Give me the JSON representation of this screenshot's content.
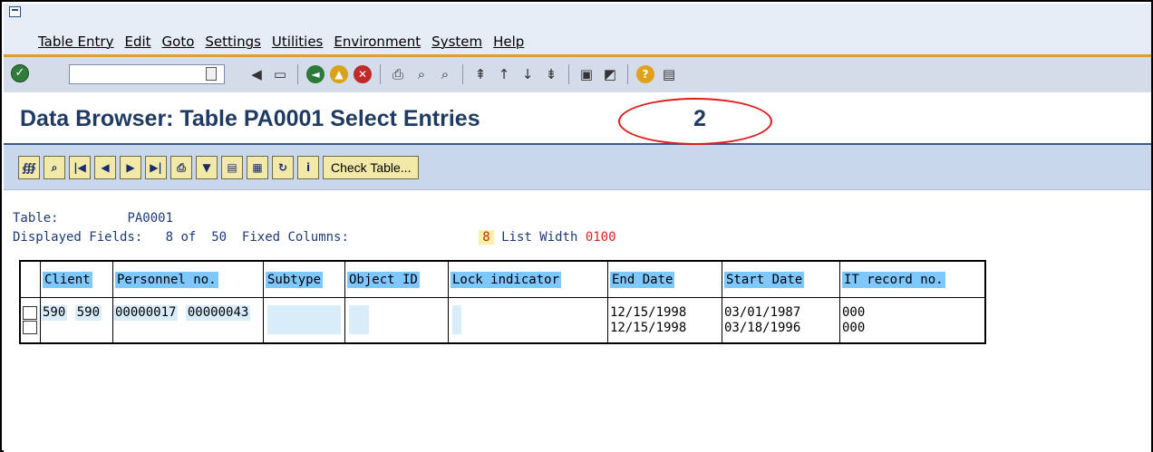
{
  "menubar": {
    "items": [
      "Table Entry",
      "Edit",
      "Goto",
      "Settings",
      "Utilities",
      "Environment",
      "System",
      "Help"
    ]
  },
  "stdbar": {
    "command_value": "",
    "icons": [
      "enter-icon",
      "command-history-icon",
      "back-icon",
      "save-icon",
      "back-nav-icon",
      "exit-icon",
      "cancel-icon",
      "print-icon",
      "find-icon",
      "find-next-icon",
      "first-page-icon",
      "previous-page-icon",
      "next-page-icon",
      "last-page-icon",
      "create-session-icon",
      "shortcut-icon",
      "help-icon",
      "layout-icon"
    ]
  },
  "title": {
    "text": "Data Browser: Table PA0001 Select Entries",
    "count": "2"
  },
  "appbar": {
    "check_table_label": "Check Table..."
  },
  "info": {
    "table_label": "Table:",
    "table_value": "PA0001",
    "displayed_label": "Displayed Fields:",
    "displayed_value": "8",
    "of_label": "of",
    "of_value": "50",
    "fixed_label": "Fixed Columns:",
    "fixed_value": "8",
    "list_width_label": "List Width",
    "list_width_value": "0100"
  },
  "grid": {
    "columns": [
      "Client",
      "Personnel no.",
      "Subtype",
      "Object ID",
      "Lock indicator",
      "End Date",
      "Start Date",
      "IT record no."
    ],
    "rows": [
      {
        "client": "590",
        "pernr": "00000017",
        "subtype": "",
        "object_id": "",
        "lock": "",
        "end_date": "12/15/1998",
        "start_date": "03/01/1987",
        "it_record": "000"
      },
      {
        "client": "590",
        "pernr": "00000043",
        "subtype": "",
        "object_id": "",
        "lock": "",
        "end_date": "12/15/1998",
        "start_date": "03/18/1996",
        "it_record": "000"
      }
    ]
  },
  "colors": {
    "accent": "#e59a2c",
    "title": "#1f3a63",
    "header_cell": "#7fc8ff",
    "highlight_ellipse": "#e11b1b"
  }
}
